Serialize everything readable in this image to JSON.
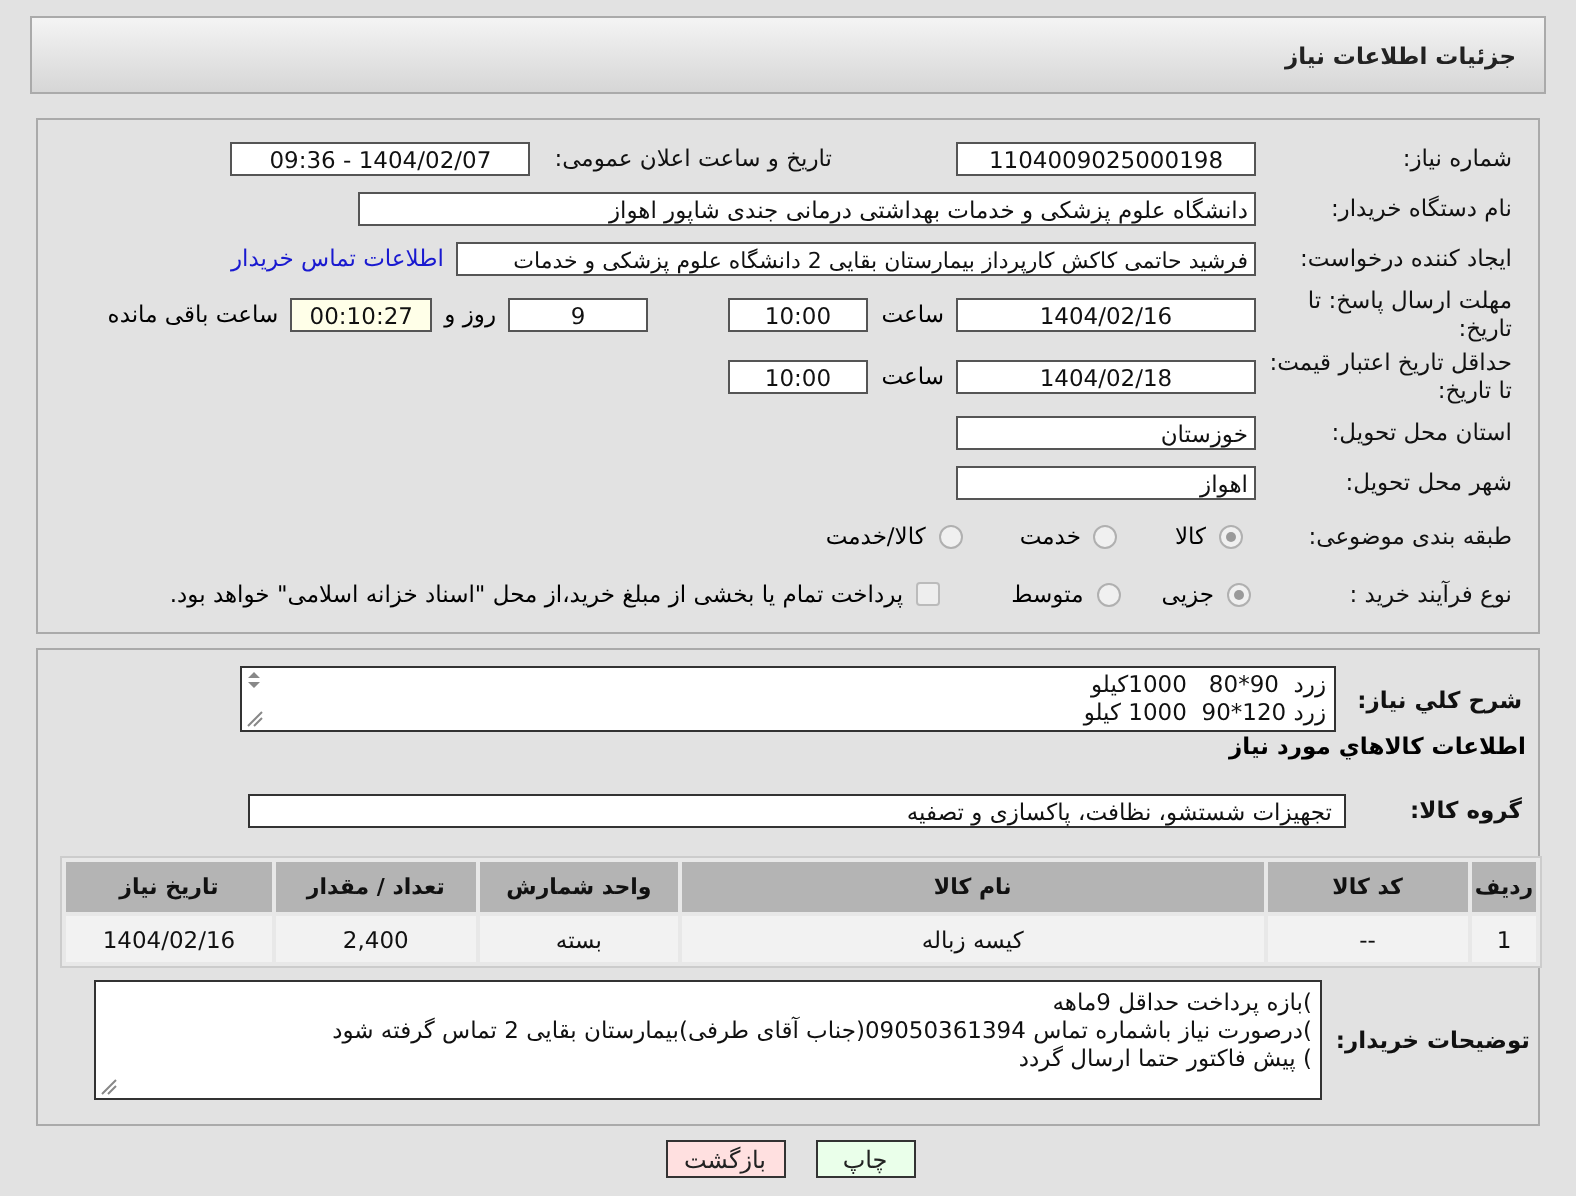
{
  "header": {
    "title": "جزئیات اطلاعات نیاز"
  },
  "need_number": {
    "label": "شماره نیاز:",
    "value": "1104009025000198"
  },
  "announce": {
    "label": "تاریخ و ساعت اعلان عمومی:",
    "value": "1404/02/07 - 09:36"
  },
  "buyer_org": {
    "label": "نام دستگاه خریدار:",
    "value": "دانشگاه علوم پزشکی و خدمات بهداشتی درمانی جندی شاپور اهواز"
  },
  "requester": {
    "label": "ایجاد کننده درخواست:",
    "value": "فرشید حاتمی کاکش کارپرداز بیمارستان بقایی 2 دانشگاه علوم پزشکی و خدمات",
    "link": "اطلاعات تماس خریدار"
  },
  "deadline": {
    "label": "مهلت ارسال پاسخ: تا تاریخ:",
    "date": "1404/02/16",
    "time_label": "ساعت",
    "time": "10:00",
    "days": "9",
    "days_label": "روز و",
    "remaining": "00:10:27",
    "remaining_label": "ساعت باقی مانده"
  },
  "price_validity": {
    "label": "حداقل تاریخ اعتبار قیمت: تا تاریخ:",
    "date": "1404/02/18",
    "time_label": "ساعت",
    "time": "10:00"
  },
  "province": {
    "label": "استان محل تحویل:",
    "value": "خوزستان"
  },
  "city": {
    "label": "شهر محل تحویل:",
    "value": "اهواز"
  },
  "category": {
    "label": "طبقه بندی موضوعی:",
    "options": [
      {
        "label": "کالا",
        "selected": true
      },
      {
        "label": "خدمت",
        "selected": false
      },
      {
        "label": "کالا/خدمت",
        "selected": false
      }
    ]
  },
  "process": {
    "label": "نوع فرآیند خرید :",
    "options": [
      {
        "label": "جزیی",
        "selected": true
      },
      {
        "label": "متوسط",
        "selected": false
      }
    ],
    "treasury": {
      "label": "پرداخت تمام یا بخشی از مبلغ خرید،از محل \"اسناد خزانه اسلامی\" خواهد بود.",
      "checked": false
    }
  },
  "summary": {
    "label": "شرح کلي نياز:",
    "value": "زرد  90*80   1000کیلو\nزرد 120*90  1000 کیلو"
  },
  "items_title": "اطلاعات کالاهاي مورد نياز",
  "goods_group": {
    "label": "گروه کالا:",
    "value": "تجهیزات شستشو، نظافت، پاکسازی و تصفیه"
  },
  "table": {
    "columns": [
      "ردیف",
      "کد کالا",
      "نام کالا",
      "واحد شمارش",
      "تعداد / مقدار",
      "تاریخ نیاز"
    ],
    "rows": [
      [
        "1",
        "--",
        "کیسه زباله",
        "بسته",
        "2,400",
        "1404/02/16"
      ]
    ]
  },
  "buyer_notes": {
    "label": "توضیحات خریدار:",
    "value": ")بازه پرداخت حداقل 9ماهه\n)درصورت نیاز باشماره تماس 09050361394(جناب آقای طرفی)بیمارستان بقایی 2 تماس گرفته شود\n) پیش فاکتور حتما ارسال گردد"
  },
  "buttons": [
    {
      "label": "چاپ",
      "kind": "print"
    },
    {
      "label": "بازگشت",
      "kind": "back"
    }
  ]
}
